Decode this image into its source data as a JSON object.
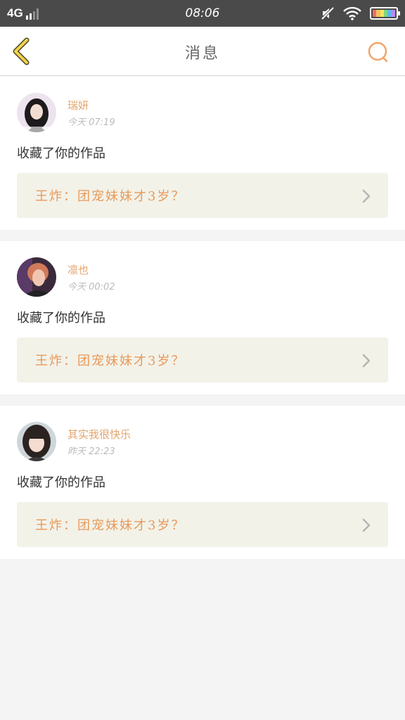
{
  "status_bar": {
    "network": "4G",
    "time": "08:06",
    "battery_colors": [
      "#f06b6b",
      "#f5c15a",
      "#f2e665",
      "#7dd87f",
      "#5fb6f2",
      "#b48cf0"
    ]
  },
  "header": {
    "title": "消息",
    "back_icon": "chevron-left-icon",
    "search_icon": "search-icon"
  },
  "colors": {
    "accent": "#e89a5a",
    "back_icon": "#f3d24a"
  },
  "messages": [
    {
      "user": "瑞妍",
      "time": "今天  07:19",
      "action": "收藏了你的作品",
      "work_title": "王炸：团宠妹妹才3岁？"
    },
    {
      "user": "凛也",
      "time": "今天  00:02",
      "action": "收藏了你的作品",
      "work_title": "王炸：团宠妹妹才3岁？"
    },
    {
      "user": "其实我很快乐",
      "time": "昨天  22:23",
      "action": "收藏了你的作品",
      "work_title": "王炸：团宠妹妹才3岁？"
    }
  ]
}
